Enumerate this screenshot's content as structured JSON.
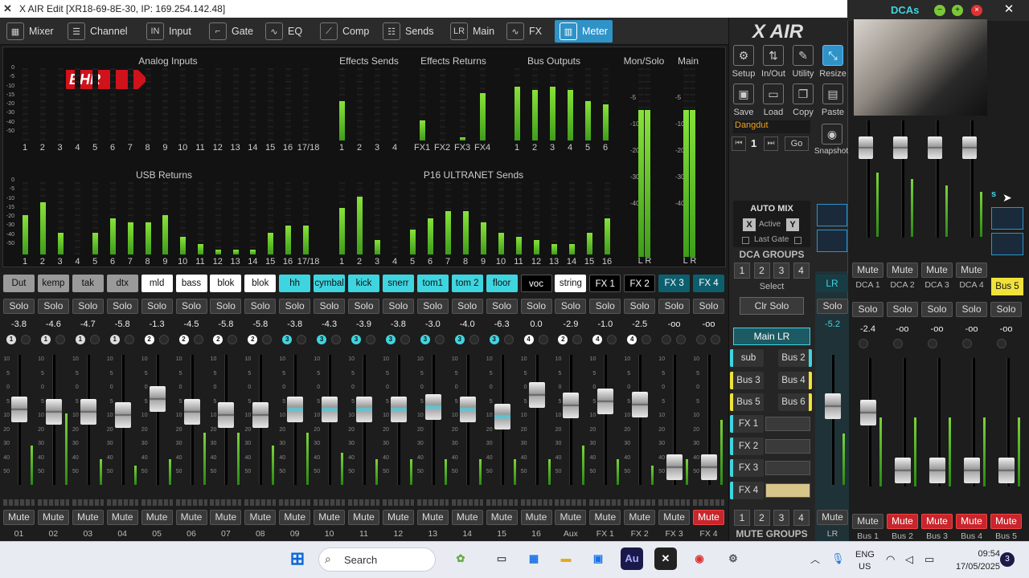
{
  "window": {
    "title": "X AIR Edit [XR18-69-8E-30, IP: 169.254.142.48]"
  },
  "tabs": [
    {
      "label": "Mixer",
      "icon": "grid"
    },
    {
      "label": "Channel",
      "icon": "sliders"
    },
    {
      "label": "Input",
      "icon": "in"
    },
    {
      "label": "Gate",
      "icon": "gate-curve"
    },
    {
      "label": "EQ",
      "icon": "eq-curve"
    },
    {
      "label": "Comp",
      "icon": "comp-curve"
    },
    {
      "label": "Sends",
      "icon": "sends-sliders"
    },
    {
      "label": "Main",
      "icon": "lr"
    },
    {
      "label": "FX",
      "icon": "wave"
    },
    {
      "label": "Meter",
      "icon": "meter",
      "active": true
    }
  ],
  "meters": {
    "logo_text": "BHR",
    "sections": {
      "analog": "Analog Inputs",
      "fxsends": "Effects Sends",
      "fxreturns": "Effects Returns",
      "busout": "Bus Outputs",
      "monsolo": "Mon/Solo",
      "main": "Main",
      "usb": "USB Returns",
      "p16": "P16 ULTRANET Sends"
    },
    "scale": [
      "0",
      "-5",
      "-10",
      "-15",
      "-20",
      "-30",
      "-40",
      "-50"
    ],
    "mainscale": [
      "-5",
      "-10",
      "-20",
      "-30",
      "-40"
    ],
    "analog_labels": [
      "1",
      "2",
      "3",
      "4",
      "5",
      "6",
      "7",
      "8",
      "9",
      "10",
      "11",
      "12",
      "13",
      "14",
      "15",
      "16",
      "17/18"
    ],
    "analog_levels": [
      0,
      0,
      0,
      0,
      0,
      0,
      0,
      0,
      0,
      0,
      0,
      0,
      0,
      0,
      0,
      0,
      0
    ],
    "fxsend_labels": [
      "1",
      "2",
      "3",
      "4"
    ],
    "fxsend_levels": [
      0.55,
      0,
      0,
      0
    ],
    "fxret_labels": [
      "FX1",
      "FX2",
      "FX3",
      "FX4"
    ],
    "fxret_levels": [
      0.28,
      0,
      0.05,
      0.66
    ],
    "busout_labels": [
      "1",
      "2",
      "3",
      "4",
      "5",
      "6"
    ],
    "busout_levels": [
      0.75,
      0.7,
      0.75,
      0.7,
      0.55,
      0.5
    ],
    "usb_labels": [
      "1",
      "2",
      "3",
      "4",
      "5",
      "6",
      "7",
      "8",
      "9",
      "10",
      "11",
      "12",
      "13",
      "14",
      "15",
      "16",
      "17/18"
    ],
    "usb_levels": [
      0.55,
      0.72,
      0.3,
      0,
      0.3,
      0.5,
      0.45,
      0.45,
      0.55,
      0.25,
      0.15,
      0.07,
      0.07,
      0.07,
      0.3,
      0.4,
      0.4
    ],
    "p16_labels": [
      "1",
      "2",
      "3",
      "4",
      "5",
      "6",
      "7",
      "8",
      "9",
      "10",
      "11",
      "12",
      "13",
      "14",
      "15",
      "16"
    ],
    "p16_levels": [
      0.65,
      0.8,
      0.2,
      0,
      0.35,
      0.5,
      0.6,
      0.6,
      0.45,
      0.3,
      0.25,
      0.2,
      0.15,
      0.15,
      0.3,
      0.5
    ],
    "lr_label": "L R",
    "monsolo_level": 0.78,
    "main_level": 0.78
  },
  "channels": [
    {
      "name": "Dut",
      "num": "01",
      "val": "-3.8",
      "dca": "1",
      "bg": "#9a9a9a",
      "fg": "#111",
      "fader": 0.6,
      "lvl": 0.3
    },
    {
      "name": "kemp",
      "num": "02",
      "val": "-4.6",
      "dca": "1",
      "bg": "#9a9a9a",
      "fg": "#111",
      "fader": 0.58,
      "lvl": 0.55
    },
    {
      "name": "tak",
      "num": "03",
      "val": "-4.7",
      "dca": "1",
      "bg": "#9a9a9a",
      "fg": "#111",
      "fader": 0.58,
      "lvl": 0.2
    },
    {
      "name": "dtx",
      "num": "04",
      "val": "-5.8",
      "dca": "1",
      "bg": "#9a9a9a",
      "fg": "#111",
      "fader": 0.55,
      "lvl": 0.15
    },
    {
      "name": "mld",
      "num": "05",
      "val": "-1.3",
      "dca": "2",
      "bg": "#ffffff",
      "fg": "#111",
      "fader": 0.7,
      "lvl": 0.2
    },
    {
      "name": "bass",
      "num": "06",
      "val": "-4.5",
      "dca": "2",
      "bg": "#ffffff",
      "fg": "#111",
      "fader": 0.58,
      "lvl": 0.4
    },
    {
      "name": "blok",
      "num": "07",
      "val": "-5.8",
      "dca": "2",
      "bg": "#ffffff",
      "fg": "#111",
      "fader": 0.55,
      "lvl": 0.4
    },
    {
      "name": "blok",
      "num": "08",
      "val": "-5.8",
      "dca": "2",
      "bg": "#ffffff",
      "fg": "#111",
      "fader": 0.55,
      "lvl": 0.3
    },
    {
      "name": "hh tmbo",
      "num": "09",
      "val": "-3.8",
      "dca": "3",
      "bg": "#3fd5e0",
      "fg": "#111",
      "fader": 0.6,
      "lvl": 0.4
    },
    {
      "name": "cymbal",
      "num": "10",
      "val": "-4.3",
      "dca": "3",
      "bg": "#3fd5e0",
      "fg": "#111",
      "fader": 0.6,
      "lvl": 0.25
    },
    {
      "name": "kick",
      "num": "11",
      "val": "-3.9",
      "dca": "3",
      "bg": "#3fd5e0",
      "fg": "#111",
      "fader": 0.6,
      "lvl": 0.2
    },
    {
      "name": "snerr",
      "num": "12",
      "val": "-3.8",
      "dca": "3",
      "bg": "#3fd5e0",
      "fg": "#111",
      "fader": 0.6,
      "lvl": 0.2
    },
    {
      "name": "tom1",
      "num": "13",
      "val": "-3.0",
      "dca": "3",
      "bg": "#3fd5e0",
      "fg": "#111",
      "fader": 0.62,
      "lvl": 0.2
    },
    {
      "name": "tom 2",
      "num": "14",
      "val": "-4.0",
      "dca": "3",
      "bg": "#3fd5e0",
      "fg": "#111",
      "fader": 0.6,
      "lvl": 0.2
    },
    {
      "name": "floor",
      "num": "15",
      "val": "-6.3",
      "dca": "3",
      "bg": "#3fd5e0",
      "fg": "#111",
      "fader": 0.53,
      "lvl": 0.2
    },
    {
      "name": "voc",
      "num": "16",
      "val": "0.0",
      "dca": "4",
      "bg": "#000000",
      "fg": "#fff",
      "fader": 0.74,
      "lvl": 0.2
    },
    {
      "name": "string",
      "num": "Aux",
      "val": "-2.9",
      "dca": "2",
      "bg": "#ffffff",
      "fg": "#111",
      "fader": 0.64,
      "lvl": 0.3
    },
    {
      "name": "FX 1",
      "num": "FX 1",
      "val": "-1.0",
      "dca": "4",
      "bg": "#000000",
      "fg": "#fff",
      "fader": 0.68,
      "lvl": 0.2
    },
    {
      "name": "FX 2",
      "num": "FX 2",
      "val": "-2.5",
      "dca": "4",
      "bg": "#000000",
      "fg": "#fff",
      "fader": 0.65,
      "lvl": 0.15
    },
    {
      "name": "FX 3",
      "num": "FX 3",
      "val": "-oo",
      "dca": "",
      "bg": "#0d5f6e",
      "fg": "#fff",
      "fader": 0.05,
      "lvl": 0.2
    },
    {
      "name": "FX 4",
      "num": "FX 4",
      "val": "-oo",
      "dca": "",
      "bg": "#0d5f6e",
      "fg": "#fff",
      "fader": 0.05,
      "lvl": 0.5,
      "mute_on": true
    }
  ],
  "labels": {
    "solo": "Solo",
    "mute": "Mute"
  },
  "fader_scale": [
    "10",
    "5",
    "0",
    "5",
    "10",
    "20",
    "30",
    "40",
    "50"
  ],
  "right": {
    "xair": "X AIR",
    "tools": [
      {
        "label": "Setup",
        "icon": "gear"
      },
      {
        "label": "In/Out",
        "icon": "arrows"
      },
      {
        "label": "Utility",
        "icon": "wrench"
      },
      {
        "label": "Resize",
        "icon": "resize",
        "active": true
      },
      {
        "label": "Save",
        "icon": "disk"
      },
      {
        "label": "Load",
        "icon": "folder"
      },
      {
        "label": "Copy",
        "icon": "copy"
      },
      {
        "label": "Paste",
        "icon": "paste"
      }
    ],
    "scene_name": "Dangdut",
    "scene_num": "1",
    "go": "Go",
    "snapshot": "Snapshot",
    "automix": "AUTO MIX",
    "active": "Active",
    "x": "X",
    "y": "Y",
    "lastgate": "Last Gate",
    "dcagroups": "DCA GROUPS",
    "dcanums": [
      "1",
      "2",
      "3",
      "4"
    ],
    "select": "Select",
    "clrsolo": "Clr Solo",
    "mainlr": "Main LR",
    "buses": [
      {
        "label": "sub",
        "color": "#3fd5e0"
      },
      {
        "label": "Bus 2",
        "color": "#3fd5e0"
      },
      {
        "label": "Bus 3",
        "color": "#f0e23a"
      },
      {
        "label": "Bus 4",
        "color": "#f0e23a"
      },
      {
        "label": "Bus 5",
        "color": "#f0e23a"
      },
      {
        "label": "Bus 6",
        "color": "#f0e23a"
      }
    ],
    "fx": [
      "FX 1",
      "FX 2",
      "FX 3",
      "FX 4"
    ],
    "mutegroups": "MUTE GROUPS",
    "mutenums": [
      "1",
      "2",
      "3",
      "4"
    ]
  },
  "lr": {
    "label": "LR",
    "solo": "Solo",
    "val": "-5.2",
    "mute": "Mute",
    "num": "LR"
  },
  "dca": {
    "title": "DCAs",
    "strips": [
      {
        "label": "DCA 1",
        "mute": "Mute"
      },
      {
        "label": "DCA 2",
        "mute": "Mute"
      },
      {
        "label": "DCA 3",
        "mute": "Mute"
      },
      {
        "label": "DCA 4",
        "mute": "Mute"
      }
    ],
    "bus5": "Bus 5",
    "fragment": "s"
  },
  "busstrips": [
    {
      "label": "Bus 1",
      "val": "-2.4",
      "muted": false,
      "fader": 0.6
    },
    {
      "label": "Bus 2",
      "val": "-oo",
      "muted": true,
      "fader": 0.05
    },
    {
      "label": "Bus 3",
      "val": "-oo",
      "muted": true,
      "fader": 0.05
    },
    {
      "label": "Bus 4",
      "val": "-oo",
      "muted": true,
      "fader": 0.05
    },
    {
      "label": "Bus 5",
      "val": "-oo",
      "muted": true,
      "fader": 0.05
    }
  ],
  "taskbar": {
    "search": "Search",
    "lang1": "ENG",
    "lang2": "US",
    "time": "09:54",
    "date": "17/05/2025",
    "badge": "3",
    "app_au": "Au"
  }
}
